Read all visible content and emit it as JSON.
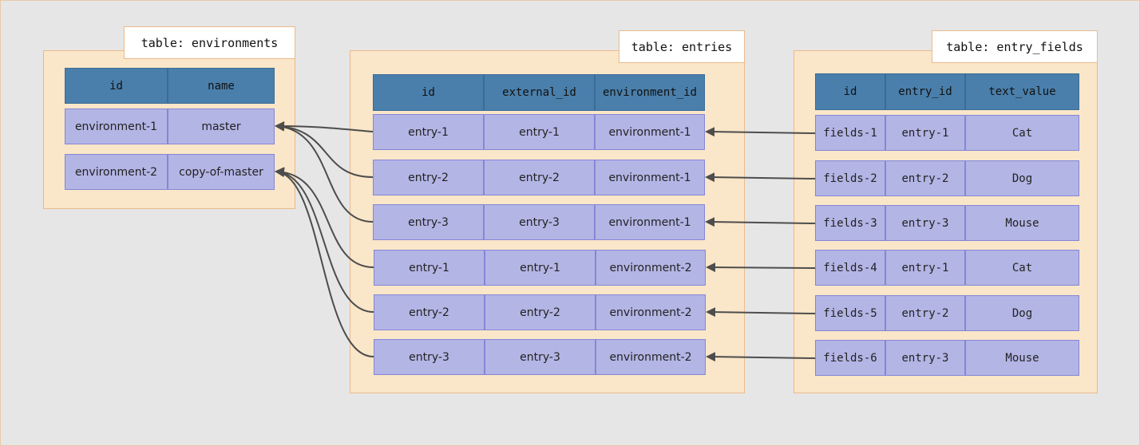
{
  "tables": {
    "environments": {
      "title": "table: environments",
      "columns": [
        "id",
        "name"
      ],
      "rows": [
        [
          "environment-1",
          "master"
        ],
        [
          "environment-2",
          "copy-of-master"
        ]
      ]
    },
    "entries": {
      "title": "table: entries",
      "columns": [
        "id",
        "external_id",
        "environment_id"
      ],
      "rows": [
        [
          "entry-1",
          "entry-1",
          "environment-1"
        ],
        [
          "entry-2",
          "entry-2",
          "environment-1"
        ],
        [
          "entry-3",
          "entry-3",
          "environment-1"
        ],
        [
          "entry-1",
          "entry-1",
          "environment-2"
        ],
        [
          "entry-2",
          "entry-2",
          "environment-2"
        ],
        [
          "entry-3",
          "entry-3",
          "environment-2"
        ]
      ]
    },
    "entry_fields": {
      "title": "table: entry_fields",
      "columns": [
        "id",
        "entry_id",
        "text_value"
      ],
      "rows": [
        [
          "fields-1",
          "entry-1",
          "Cat"
        ],
        [
          "fields-2",
          "entry-2",
          "Dog"
        ],
        [
          "fields-3",
          "entry-3",
          "Mouse"
        ],
        [
          "fields-4",
          "entry-1",
          "Cat"
        ],
        [
          "fields-5",
          "entry-2",
          "Dog"
        ],
        [
          "fields-6",
          "entry-3",
          "Mouse"
        ]
      ]
    }
  },
  "colors": {
    "background": "#e6e6e6",
    "panel_fill": "#fae6c8",
    "header_fill": "#4a7fab",
    "row_fill": "#b3b5e5",
    "arrow": "#4d4d4d"
  }
}
